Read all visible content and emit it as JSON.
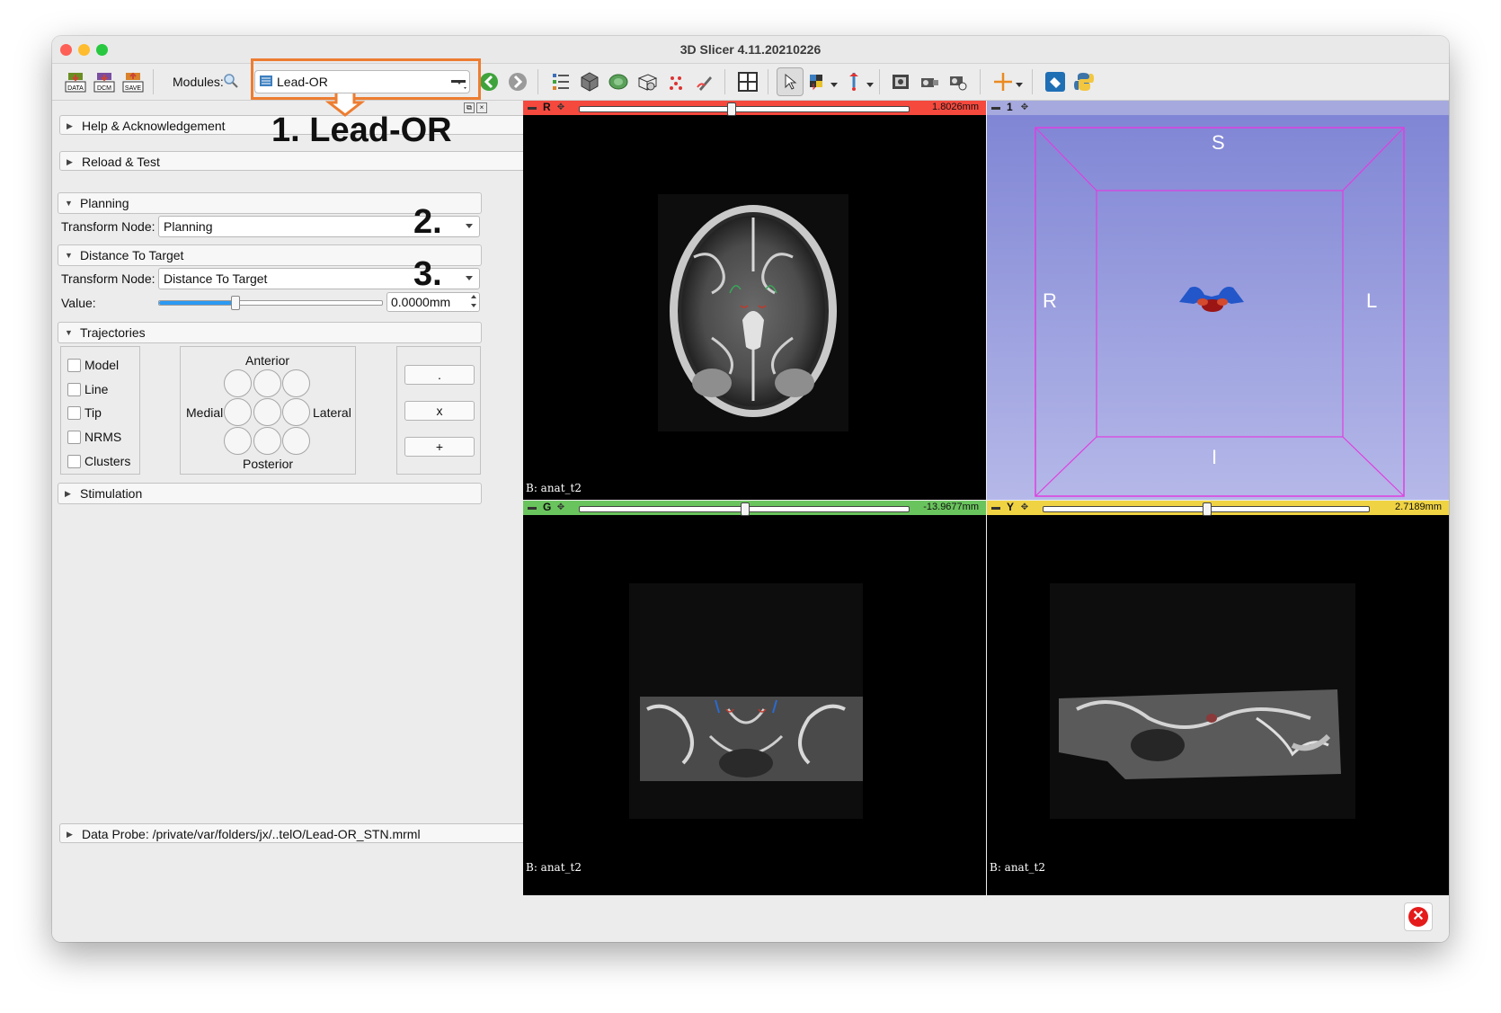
{
  "window": {
    "title": "3D Slicer 4.11.20210226",
    "traffic_colors": [
      "#fe5f57",
      "#febc2e",
      "#28c840"
    ]
  },
  "toolbar": {
    "data_label": "DATA",
    "dcm_label": "DCM",
    "save_label": "SAVE",
    "modules_label": "Modules:",
    "selected_module": "Lead-OR"
  },
  "annotations": {
    "step1": "1. Lead-OR",
    "step2": "2.",
    "step3": "3.",
    "highlight_color": "#ed7d31"
  },
  "panel": {
    "help": "Help & Acknowledgement",
    "reload": "Reload & Test",
    "planning": {
      "title": "Planning",
      "transform_label": "Transform Node:",
      "transform_value": "Planning"
    },
    "distance": {
      "title": "Distance To Target",
      "transform_label": "Transform Node:",
      "transform_value": "Distance To Target",
      "value_label": "Value:",
      "value": "0.0000mm",
      "slider_fraction": 0.34
    },
    "trajectories": {
      "title": "Trajectories",
      "checkboxes": [
        "Model",
        "Line",
        "Tip",
        "NRMS",
        "Clusters"
      ],
      "anterior": "Anterior",
      "posterior": "Posterior",
      "medial": "Medial",
      "lateral": "Lateral",
      "buttons": [
        ".",
        "x",
        "+"
      ]
    },
    "stimulation": "Stimulation",
    "data_probe": "Data Probe: /private/var/folders/jx/..telO/Lead-OR_STN.mrml"
  },
  "views": {
    "red": {
      "letter": "R",
      "offset": "1.8026mm",
      "slider_fraction": 0.46,
      "bg_label": "B: anat_t2",
      "color": "#f5493e"
    },
    "threeD": {
      "number": "1",
      "labels": {
        "S": "S",
        "R": "R",
        "L": "L",
        "I": "I"
      },
      "color": "#7e84d4"
    },
    "green": {
      "letter": "G",
      "offset": "-13.9677mm",
      "slider_fraction": 0.5,
      "bg_label": "B: anat_t2",
      "color": "#6ac45d"
    },
    "yellow": {
      "letter": "Y",
      "offset": "2.7189mm",
      "slider_fraction": 0.5,
      "bg_label": "B: anat_t2",
      "color": "#f0d343"
    }
  }
}
